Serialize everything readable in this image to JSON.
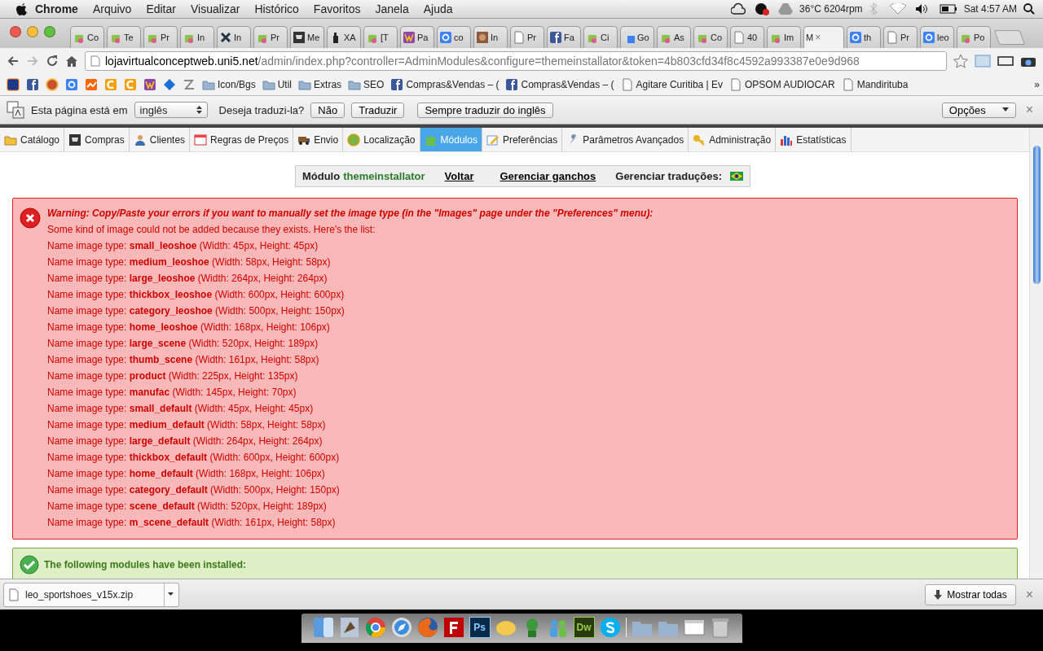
{
  "menu_bar": {
    "app": "Chrome",
    "items": [
      "Arquivo",
      "Editar",
      "Visualizar",
      "Histórico",
      "Favoritos",
      "Janela",
      "Ajuda"
    ],
    "temperature": "36°C 6204rpm",
    "clock": "Sat 4:57 AM"
  },
  "tabs": [
    {
      "title": "Co",
      "kind": "shop",
      "selected": false
    },
    {
      "title": "Te",
      "kind": "shop",
      "selected": false
    },
    {
      "title": "Pr",
      "kind": "shop",
      "selected": false
    },
    {
      "title": "In",
      "kind": "shop",
      "selected": false
    },
    {
      "title": "In",
      "kind": "tools",
      "selected": false
    },
    {
      "title": "Pr",
      "kind": "shop",
      "selected": false
    },
    {
      "title": "Me",
      "kind": "cart",
      "selected": false
    },
    {
      "title": "XA",
      "kind": "spray",
      "selected": false
    },
    {
      "title": "[T",
      "kind": "shop",
      "selected": false
    },
    {
      "title": "Pa",
      "kind": "w",
      "selected": false
    },
    {
      "title": "co",
      "kind": "google",
      "selected": false
    },
    {
      "title": "In",
      "kind": "image",
      "selected": false
    },
    {
      "title": "Pr",
      "kind": "doc",
      "selected": false
    },
    {
      "title": "Fa",
      "kind": "facebook",
      "selected": false
    },
    {
      "title": "Ci",
      "kind": "shop",
      "selected": false
    },
    {
      "title": "Go",
      "kind": "translate",
      "selected": false
    },
    {
      "title": "As",
      "kind": "shop",
      "selected": false
    },
    {
      "title": "Co",
      "kind": "shop",
      "selected": false
    },
    {
      "title": "40",
      "kind": "doc",
      "selected": false
    },
    {
      "title": "Im",
      "kind": "shop",
      "selected": false
    },
    {
      "title": "M",
      "kind": "none",
      "selected": true,
      "close": "×"
    },
    {
      "title": "th",
      "kind": "google",
      "selected": false
    },
    {
      "title": "Pr",
      "kind": "doc",
      "selected": false
    },
    {
      "title": "leo",
      "kind": "google",
      "selected": false
    },
    {
      "title": "Po",
      "kind": "shop",
      "selected": false
    }
  ],
  "address": {
    "host": "lojavirtualconceptweb.uni5.net",
    "path": "/admin/index.php?controller=AdminModules&configure=themeinstallator&token=4b803cfd34f8c4592a993387e0e9d968"
  },
  "bookmarks": [
    {
      "kind": "bank"
    },
    {
      "kind": "facebook_icon"
    },
    {
      "kind": "pizza"
    },
    {
      "kind": "google"
    },
    {
      "kind": "chart"
    },
    {
      "kind": "c"
    },
    {
      "kind": "c"
    },
    {
      "kind": "w"
    },
    {
      "kind": "diamond"
    },
    {
      "kind": "z"
    },
    {
      "kind": "folder",
      "label": "Icon/Bgs"
    },
    {
      "kind": "folder",
      "label": "Util"
    },
    {
      "kind": "folder",
      "label": "Extras"
    },
    {
      "kind": "folder",
      "label": "SEO"
    },
    {
      "kind": "facebook",
      "label": "Compras&Vendas – ("
    },
    {
      "kind": "facebook",
      "label": "Compras&Vendas – ("
    },
    {
      "kind": "page",
      "label": "Agitare Curitiba | Ev"
    },
    {
      "kind": "page",
      "label": "OPSOM AUDIOCAR"
    },
    {
      "kind": "page",
      "label": "Mandirituba"
    }
  ],
  "bookmarks_more": "»",
  "translate_bar": {
    "prefix": "Esta página está em",
    "language": "inglês",
    "question": "Deseja traduzi-la?",
    "buttons": [
      "Não",
      "Traduzir",
      "Sempre traduzir do inglês"
    ],
    "options": "Opções",
    "close": "×"
  },
  "admin_tabs": [
    {
      "label": "Catálogo",
      "selected": false
    },
    {
      "label": "Compras",
      "selected": false
    },
    {
      "label": "Clientes",
      "selected": false
    },
    {
      "label": "Regras de Preços",
      "selected": false
    },
    {
      "label": "Envio",
      "selected": false
    },
    {
      "label": "Localização",
      "selected": false
    },
    {
      "label": "Módulos",
      "selected": true
    },
    {
      "label": "Preferências",
      "selected": false
    },
    {
      "label": "Parâmetros Avançados",
      "selected": false
    },
    {
      "label": "Administração",
      "selected": false
    },
    {
      "label": "Estatísticas",
      "selected": false
    }
  ],
  "module_bar": {
    "label": "Módulo",
    "name": "themeinstallator",
    "links": [
      "Voltar",
      "Gerenciar ganchos"
    ],
    "translations": "Gerenciar traduções:"
  },
  "error": {
    "title": "Warning: Copy/Paste your errors if you want to manually set the image type (in the \"Images\" page under the \"Preferences\" menu):",
    "intro": "Some kind of image could not be added because they exists. Here's the list:",
    "lines": [
      "Name image type: **small_leoshoe** (Width: 45px, Height: 45px)",
      "Name image type: **medium_leoshoe** (Width: 58px, Height: 58px)",
      "Name image type: **large_leoshoe** (Width: 264px, Height: 264px)",
      "Name image type: **thickbox_leoshoe** (Width: 600px, Height: 600px)",
      "Name image type: **category_leoshoe** (Width: 500px, Height: 150px)",
      "Name image type: **home_leoshoe** (Width: 168px, Height: 106px)",
      "Name image type: **large_scene** (Width: 520px, Height: 189px)",
      "Name image type: **thumb_scene** (Width: 161px, Height: 58px)",
      "Name image type: **product** (Width: 225px, Height: 135px)",
      "Name image type: **manufac** (Width: 145px, Height: 70px)",
      "Name image type: **small_default** (Width: 45px, Height: 45px)",
      "Name image type: **medium_default** (Width: 58px, Height: 58px)",
      "Name image type: **large_default** (Width: 264px, Height: 264px)",
      "Name image type: **thickbox_default** (Width: 600px, Height: 600px)",
      "Name image type: **home_default** (Width: 168px, Height: 106px)",
      "Name image type: **category_default** (Width: 500px, Height: 150px)",
      "Name image type: **scene_default** (Width: 520px, Height: 189px)",
      "Name image type: **m_scene_default** (Width: 161px, Height: 58px)"
    ]
  },
  "success": {
    "title": "The following modules have been installed:"
  },
  "download_bar": {
    "file": "leo_sportshoes_v15x.zip",
    "show_all": "Mostrar todas",
    "close": "×"
  },
  "dock": [
    {
      "kind": "finder"
    },
    {
      "kind": "preview"
    },
    {
      "kind": "chrome"
    },
    {
      "kind": "safari"
    },
    {
      "kind": "firefox"
    },
    {
      "kind": "filezilla"
    },
    {
      "kind": "ps",
      "label": "Ps"
    },
    {
      "kind": "pasta"
    },
    {
      "kind": "alien"
    },
    {
      "kind": "people"
    },
    {
      "kind": "dw",
      "label": "Dw"
    },
    {
      "kind": "skype"
    },
    {
      "kind": "sep"
    },
    {
      "kind": "folder"
    },
    {
      "kind": "folder"
    },
    {
      "kind": "window"
    },
    {
      "kind": "trash"
    }
  ]
}
